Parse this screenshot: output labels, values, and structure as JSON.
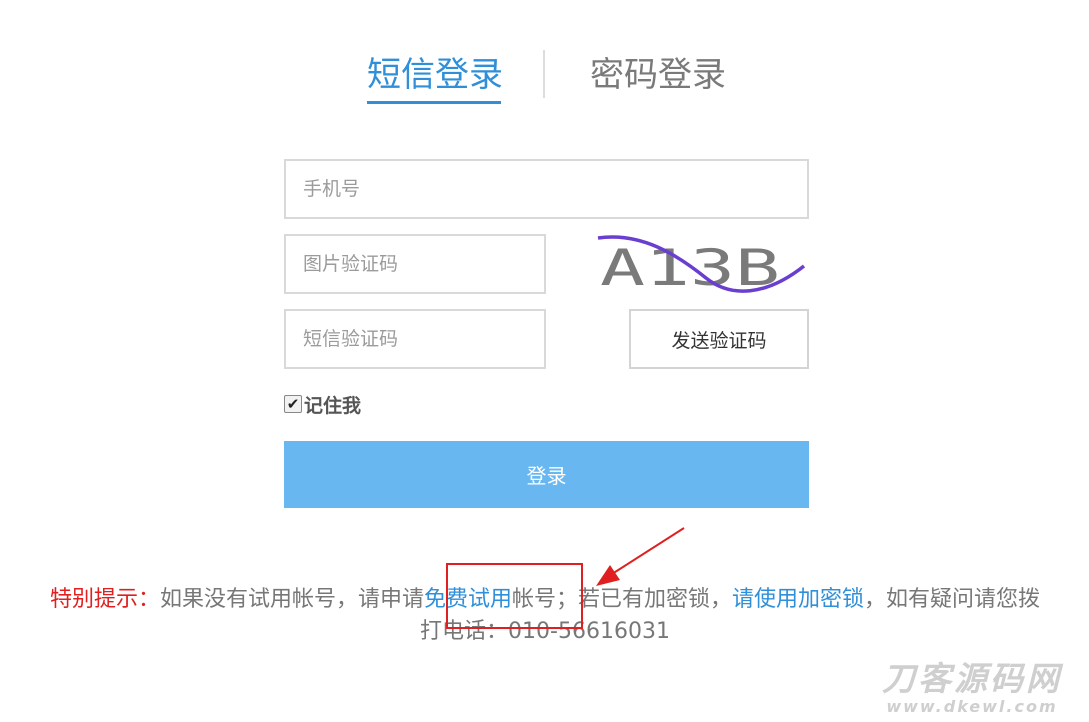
{
  "tabs": {
    "sms_login": "短信登录",
    "password_login": "密码登录"
  },
  "form": {
    "phone_placeholder": "手机号",
    "image_captcha_placeholder": "图片验证码",
    "captcha_text": "A13B",
    "sms_code_placeholder": "短信验证码",
    "send_code_label": "发送验证码",
    "remember_me_label": "记住我",
    "remember_me_checked": true,
    "login_label": "登录"
  },
  "notice": {
    "prefix": "特别提示：",
    "text1": "如果没有试用帐号，请申请",
    "free_trial_link": "免费试用",
    "text2": "帐号；若已有加密锁，",
    "use_lock_link": "请使用加密锁",
    "text3": "，如有疑问请您拨打电话：010-56616031"
  },
  "watermark": {
    "main": "刀客源码网",
    "sub": "www.dkewl.com"
  },
  "colors": {
    "accent": "#2f8fd8",
    "login_button": "#69b7f0",
    "notice_highlight": "#e02020",
    "annotation": "#e02020"
  }
}
